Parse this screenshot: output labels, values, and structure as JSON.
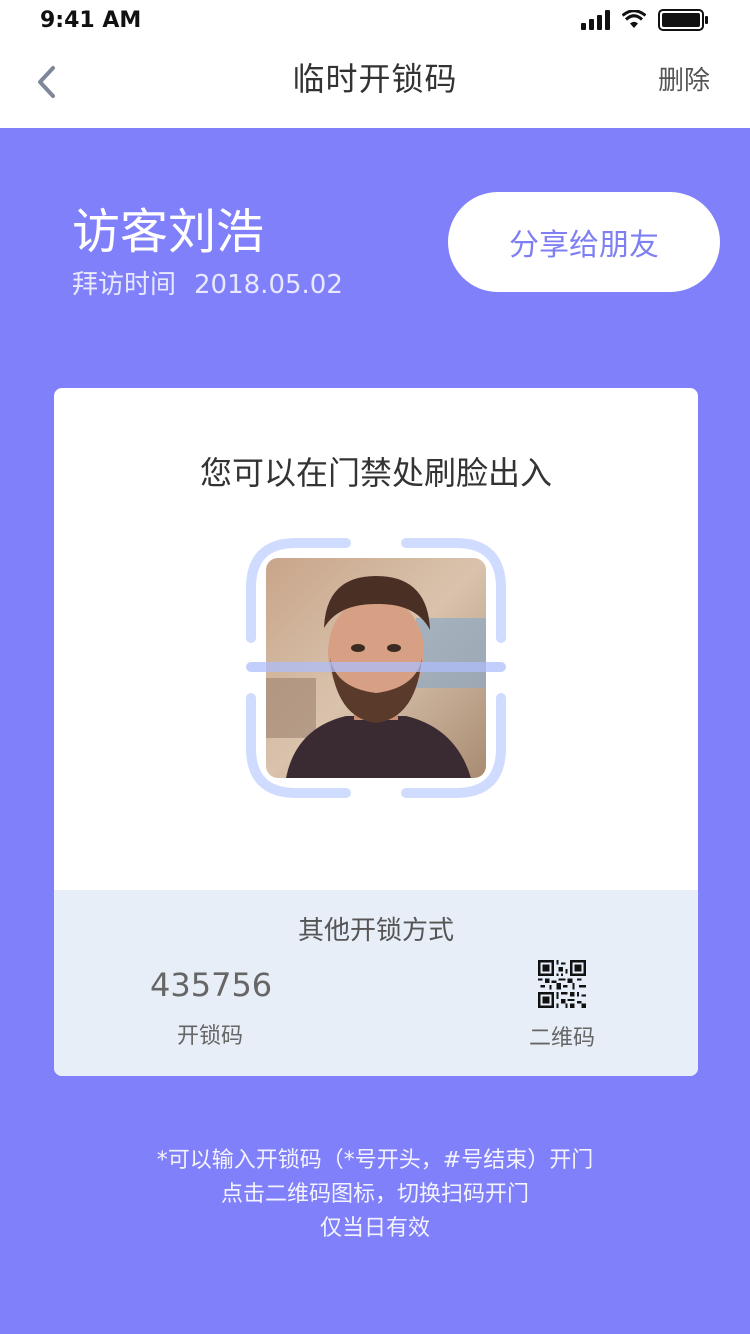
{
  "status_bar": {
    "time": "9:41 AM"
  },
  "nav": {
    "title": "临时开锁码",
    "action_label": "删除"
  },
  "visitor": {
    "name": "访客刘浩",
    "visit_time_label": "拜访时间",
    "visit_date": "2018.05.02"
  },
  "share_button": "分享给朋友",
  "card": {
    "title": "您可以在门禁处刷脸出入",
    "other_methods": {
      "title": "其他开锁方式",
      "code_value": "435756",
      "code_label": "开锁码",
      "qr_label": "二维码"
    }
  },
  "notes": [
    "*可以输入开锁码（*号开头，#号结束）开门",
    "点击二维码图标，切换扫码开门",
    "仅当日有效"
  ],
  "colors": {
    "background": "#8080fb",
    "accent": "#7f7ff4",
    "frame": "#cfdcff",
    "section_bg": "#e8eef7"
  },
  "icons": {
    "back": "chevron-left-icon",
    "qr": "qr-code-icon"
  }
}
